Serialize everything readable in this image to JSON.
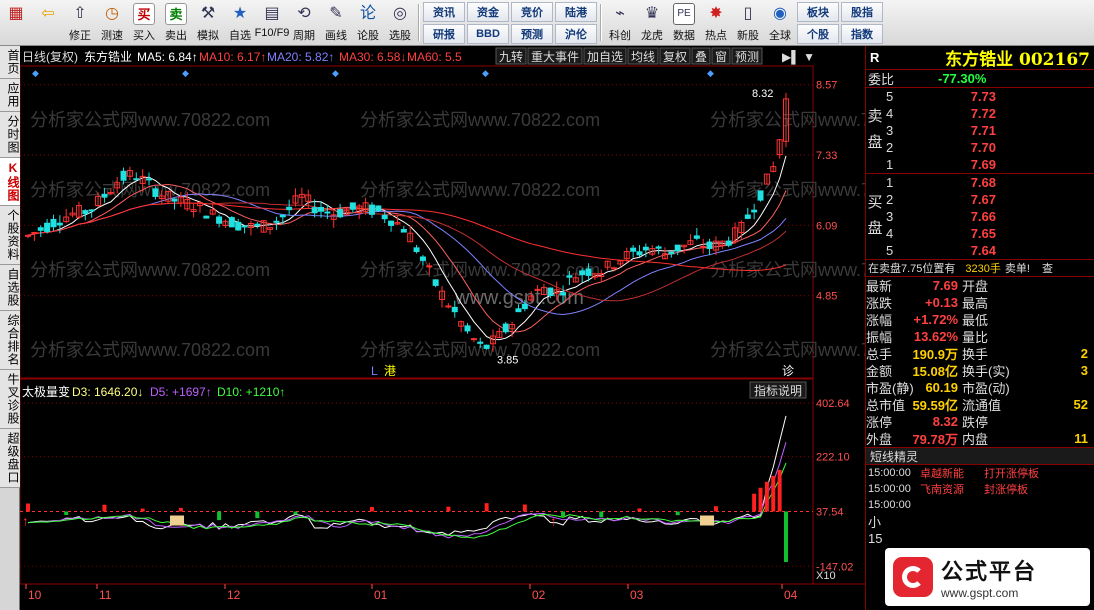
{
  "toolbar": {
    "buttons": [
      {
        "icon": "grid-icon",
        "label": ""
      },
      {
        "icon": "back-arrow-icon",
        "label": ""
      },
      {
        "icon": "restore-icon",
        "label": "修正"
      },
      {
        "icon": "clock-icon",
        "label": "测速"
      },
      {
        "icon": "buy-icon",
        "label": "买入",
        "glyph": "买"
      },
      {
        "icon": "sell-icon",
        "label": "卖出",
        "glyph": "卖"
      },
      {
        "icon": "hammer-icon",
        "label": "模拟"
      },
      {
        "icon": "star-folder-icon",
        "label": "自选"
      },
      {
        "icon": "f10-icon",
        "label": "F10/F9"
      },
      {
        "icon": "period-icon",
        "label": "周期"
      },
      {
        "icon": "pencil-icon",
        "label": "画线"
      },
      {
        "icon": "lun-icon",
        "label": "论股",
        "glyph": "论"
      },
      {
        "icon": "select-icon",
        "label": "选股"
      }
    ],
    "small_buttons": [
      [
        "资讯",
        "研报"
      ],
      [
        "资金",
        "BBD"
      ],
      [
        "竞价",
        "预测"
      ],
      [
        "陆港",
        "沪伦"
      ]
    ],
    "buttons2": [
      {
        "icon": "science-icon",
        "label": "科创"
      },
      {
        "icon": "dragon-icon",
        "label": "龙虎"
      },
      {
        "icon": "pe-icon",
        "label": "数据"
      },
      {
        "icon": "hot-icon",
        "label": "热点"
      },
      {
        "icon": "ipo-icon",
        "label": "新股"
      },
      {
        "icon": "globe-icon",
        "label": "全球"
      }
    ],
    "small_buttons2": [
      [
        "板块",
        "个股"
      ],
      [
        "股指",
        "指数"
      ]
    ]
  },
  "left_tabs": [
    "首页",
    "应用",
    "分时图",
    "K线图",
    "个股资料",
    "自选股",
    "综合排名",
    "牛叉诊股",
    "超级盘口"
  ],
  "active_tab": "K线图",
  "main_chart": {
    "header_title": "日线(复权)",
    "stock_name": "东方锆业",
    "ma_labels": [
      {
        "text": "MA5: 6.84↑",
        "color": "#ffffff"
      },
      {
        "text": "MA10: 6.17↑",
        "color": "#ff4040"
      },
      {
        "text": "MA20: 5.82↑",
        "color": "#8080ff"
      },
      {
        "text": "MA30: 6.58↓",
        "color": "#ff4040"
      },
      {
        "text": "MA60: 5.5",
        "color": "#ff4040"
      }
    ],
    "menu_buttons": [
      "九转",
      "重大事件",
      "加自选",
      "均线",
      "复权",
      "叠",
      "窗",
      "预测"
    ],
    "price_ticks": [
      "8.57",
      "7.33",
      "6.09",
      "4.85"
    ],
    "max_label": "8.32",
    "min_label": "3.85",
    "marker_l": "L",
    "marker_port": "港",
    "marker_diag": "诊",
    "watermark": "分析家公式网www.70822.com",
    "watermark_center": "www.gspt.com"
  },
  "indicator": {
    "name": "太极量变",
    "d3": "D3: 1646.20↓",
    "d5": "D5: +1697↑",
    "d10": "D10: +1210↑",
    "explain_button": "指标说明",
    "ticks": [
      "402.64",
      "222.10",
      "37.54",
      "-147.02"
    ],
    "scale_label": "X10"
  },
  "x_axis": [
    "10",
    "11",
    "12",
    "01",
    "02",
    "03",
    "04"
  ],
  "chart_data": {
    "type": "candlestick",
    "title": "东方锆业 日线(复权)",
    "x_axis_labels": [
      "10",
      "11",
      "12",
      "01",
      "02",
      "03",
      "04"
    ],
    "ylim": [
      3.85,
      8.57
    ],
    "y_ticks": [
      8.57,
      7.33,
      6.09,
      4.85
    ],
    "high": 8.32,
    "low": 3.85,
    "close_trend": [
      5.9,
      6.05,
      6.2,
      6.3,
      6.35,
      6.6,
      6.9,
      7.0,
      6.8,
      6.6,
      6.5,
      6.45,
      6.3,
      6.2,
      6.1,
      6.05,
      6.1,
      6.3,
      6.6,
      6.4,
      6.3,
      6.35,
      6.4,
      6.35,
      6.2,
      6.0,
      5.5,
      5.0,
      4.6,
      4.2,
      3.9,
      4.1,
      4.4,
      4.8,
      5.0,
      4.9,
      5.2,
      5.3,
      5.3,
      5.5,
      5.6,
      5.7,
      5.6,
      5.7,
      5.8,
      5.7,
      5.8,
      6.0,
      6.5,
      7.0,
      7.69
    ],
    "ma_series": [
      "MA5",
      "MA10",
      "MA20",
      "MA30",
      "MA60"
    ]
  },
  "right_panel": {
    "r_mark": "R",
    "stock_title": "东方锆业 002167",
    "weibi_label": "委比",
    "weibi_value": "-77.30%",
    "sell_label": [
      "卖",
      "盘"
    ],
    "buy_label": [
      "买",
      "盘"
    ],
    "sell_book": [
      [
        "5",
        "7.73"
      ],
      [
        "4",
        "7.72"
      ],
      [
        "3",
        "7.71"
      ],
      [
        "2",
        "7.70"
      ],
      [
        "1",
        "7.69"
      ]
    ],
    "buy_book": [
      [
        "1",
        "7.68"
      ],
      [
        "2",
        "7.67"
      ],
      [
        "3",
        "7.66"
      ],
      [
        "4",
        "7.65"
      ],
      [
        "5",
        "7.64"
      ]
    ],
    "pending_text": "在卖盘7.75位置有",
    "pending_qty": "3230手",
    "pending_tail": "卖单!",
    "pending_more": "查",
    "quotes": [
      {
        "k": "最新",
        "v": "7.69",
        "vc": "#ff4040",
        "k2": "开盘",
        "v2": ""
      },
      {
        "k": "涨跌",
        "v": "+0.13",
        "vc": "#ff4040",
        "k2": "最高",
        "v2": ""
      },
      {
        "k": "涨幅",
        "v": "+1.72%",
        "vc": "#ff4040",
        "k2": "最低",
        "v2": ""
      },
      {
        "k": "振幅",
        "v": "13.62%",
        "vc": "#ff4040",
        "k2": "量比",
        "v2": ""
      },
      {
        "k": "总手",
        "v": "190.9万",
        "vc": "#ffd000",
        "k2": "换手",
        "v2": "2"
      },
      {
        "k": "金额",
        "v": "15.08亿",
        "vc": "#ffd000",
        "k2": "换手(实)",
        "v2": "3"
      },
      {
        "k": "市盈(静)",
        "v": "60.19",
        "vc": "#ffd000",
        "k2": "市盈(动)",
        "v2": ""
      },
      {
        "k": "总市值",
        "v": "59.59亿",
        "vc": "#ffd000",
        "k2": "流通值",
        "v2": "52"
      },
      {
        "k": "涨停",
        "v": "8.32",
        "vc": "#ff4040",
        "k2": "跌停",
        "v2": ""
      },
      {
        "k": "外盘",
        "v": "79.78万",
        "vc": "#ff4040",
        "k2": "内盘",
        "v2": "11"
      }
    ],
    "sprite_title": "短线精灵",
    "sprites": [
      {
        "t": "15:00:00",
        "n": "卓越新能",
        "e": "打开涨停板"
      },
      {
        "t": "15:00:00",
        "n": "飞南资源",
        "e": "封涨停板"
      },
      {
        "t": "15:00:00",
        "n": "",
        "e": ""
      }
    ],
    "bottom_label": "小",
    "bottom_label2": "15"
  },
  "brand": {
    "name": "公式平台",
    "url": "www.gspt.com"
  },
  "colors": {
    "up": "#ff3030",
    "down": "#20e0e0",
    "grid": "#8b0000",
    "axis_text": "#ff5050"
  }
}
